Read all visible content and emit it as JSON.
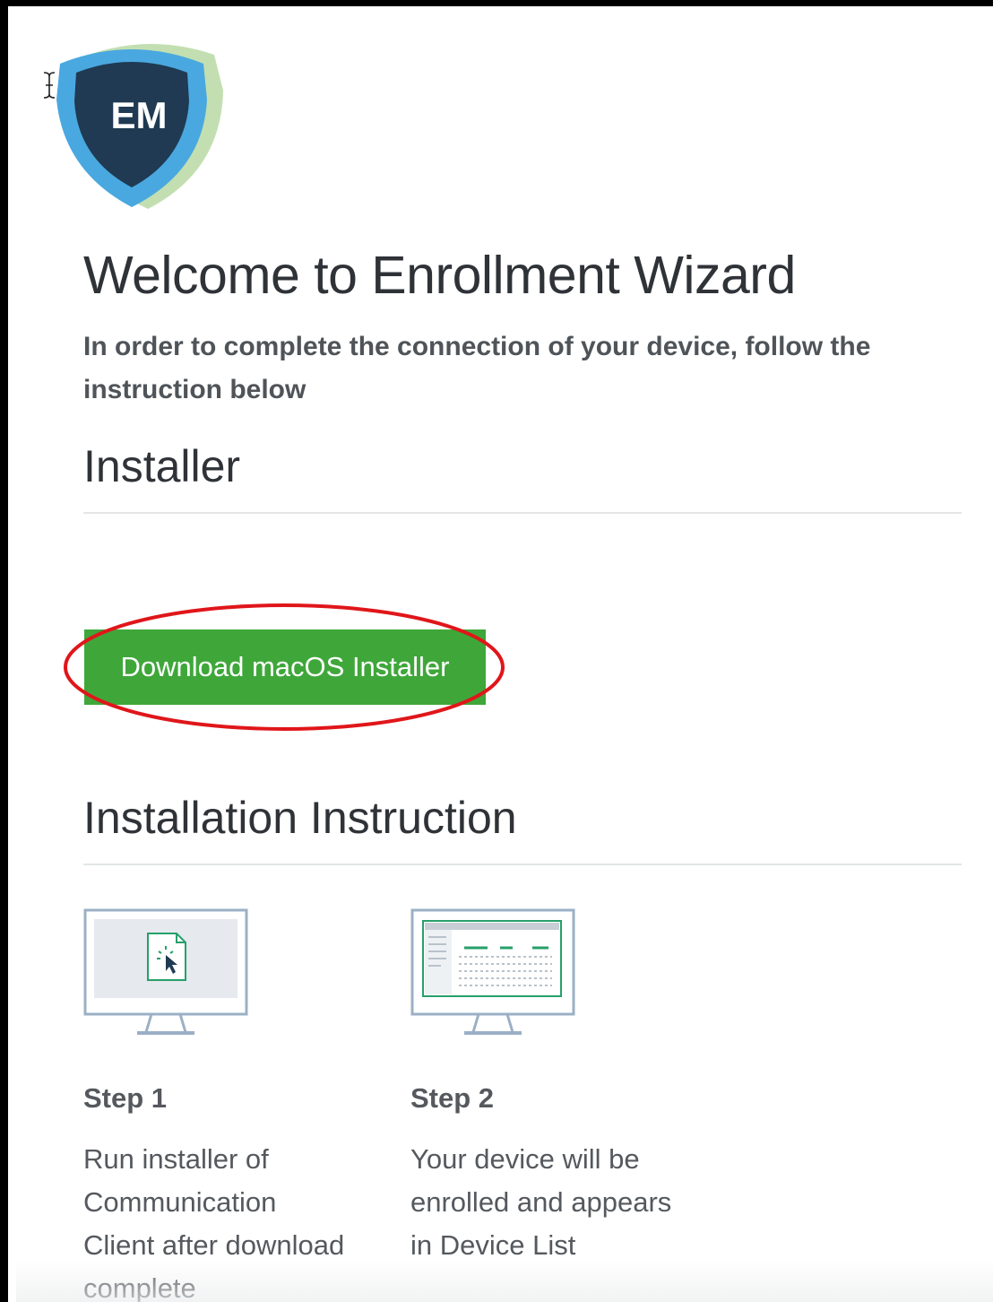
{
  "logo": {
    "text": "EM",
    "icon": "shield-logo-icon",
    "colors": {
      "outer": "#4aa8e0",
      "inner": "#1f3a52",
      "accent": "#a8cf8e"
    }
  },
  "header": {
    "title": "Welcome to Enrollment Wizard",
    "subtitle": "In order to complete the connection of your device, follow the instruction below"
  },
  "installer": {
    "heading": "Installer",
    "download_button_label": "Download macOS Installer",
    "button_color": "#3fa73a",
    "highlight_color": "#e0161a"
  },
  "instructions": {
    "heading": "Installation Instruction",
    "steps": [
      {
        "title": "Step 1",
        "description": "Run installer of Communication Client after download complete",
        "icon": "monitor-download-file-icon"
      },
      {
        "title": "Step 2",
        "description": "Your device will be enrolled and appears in Device List",
        "icon": "monitor-device-list-icon"
      }
    ]
  }
}
